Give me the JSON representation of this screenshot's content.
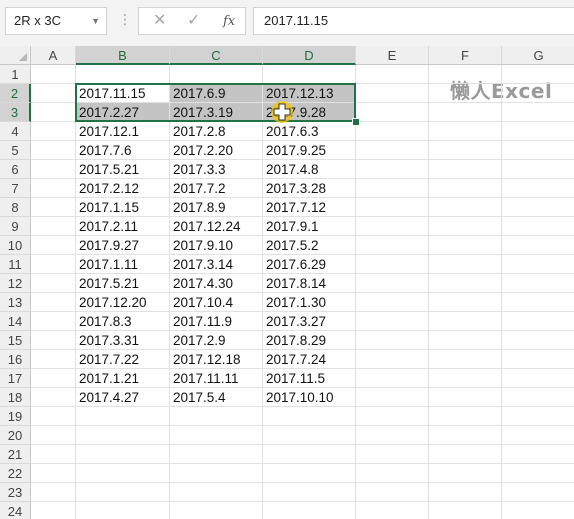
{
  "name_box": {
    "value": "2R x 3C"
  },
  "formula_bar": {
    "cancel_icon": "x-icon",
    "enter_icon": "check-icon",
    "fx_label": "fx",
    "value": "2017.11.15"
  },
  "watermark": "懒人Excel",
  "columns": [
    "A",
    "B",
    "C",
    "D",
    "E",
    "F",
    "G"
  ],
  "selected_columns": [
    "B",
    "C",
    "D"
  ],
  "rows": [
    "1",
    "2",
    "3",
    "4",
    "5",
    "6",
    "7",
    "8",
    "9",
    "10",
    "11",
    "12",
    "13",
    "14",
    "15",
    "16",
    "17",
    "18",
    "19",
    "20",
    "21",
    "22",
    "23",
    "24"
  ],
  "selected_rows": [
    "2",
    "3"
  ],
  "cells": [
    [
      "",
      "",
      "",
      ""
    ],
    [
      "",
      "2017.11.15",
      "2017.6.9",
      "2017.12.13"
    ],
    [
      "",
      "2017.2.27",
      "2017.3.19",
      "2017.9.28"
    ],
    [
      "",
      "2017.12.1",
      "2017.2.8",
      "2017.6.3"
    ],
    [
      "",
      "2017.7.6",
      "2017.2.20",
      "2017.9.25"
    ],
    [
      "",
      "2017.5.21",
      "2017.3.3",
      "2017.4.8"
    ],
    [
      "",
      "2017.2.12",
      "2017.7.2",
      "2017.3.28"
    ],
    [
      "",
      "2017.1.15",
      "2017.8.9",
      "2017.7.12"
    ],
    [
      "",
      "2017.2.11",
      "2017.12.24",
      "2017.9.1"
    ],
    [
      "",
      "2017.9.27",
      "2017.9.10",
      "2017.5.2"
    ],
    [
      "",
      "2017.1.11",
      "2017.3.14",
      "2017.6.29"
    ],
    [
      "",
      "2017.5.21",
      "2017.4.30",
      "2017.8.14"
    ],
    [
      "",
      "2017.12.20",
      "2017.10.4",
      "2017.1.30"
    ],
    [
      "",
      "2017.8.3",
      "2017.11.9",
      "2017.3.27"
    ],
    [
      "",
      "2017.3.31",
      "2017.2.9",
      "2017.8.29"
    ],
    [
      "",
      "2017.7.22",
      "2017.12.18",
      "2017.7.24"
    ],
    [
      "",
      "2017.1.21",
      "2017.11.11",
      "2017.11.5"
    ],
    [
      "",
      "2017.4.27",
      "2017.5.4",
      "2017.10.10"
    ]
  ],
  "colors": {
    "accent": "#217346",
    "selection_fill": "#c4c4c4",
    "cursor": "#f5c400"
  }
}
